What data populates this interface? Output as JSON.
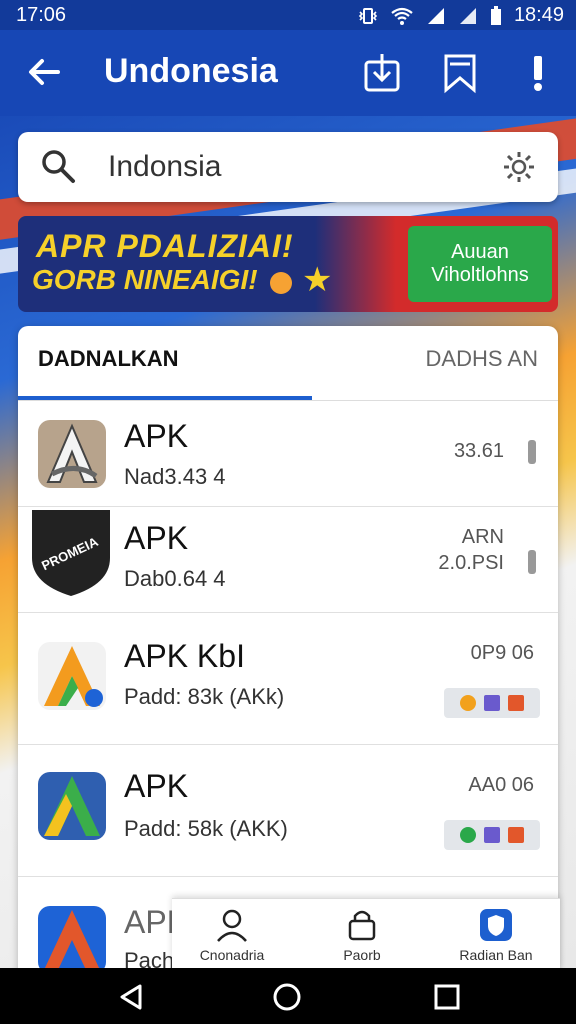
{
  "status": {
    "time_left": "17:06",
    "time_right": "18:49"
  },
  "appbar": {
    "title": "Undonesia"
  },
  "search": {
    "value": "Indonsia"
  },
  "banner": {
    "line1": "APR PDALIZIAI!",
    "line2": "GORB NINEAIGI!",
    "cta_line1": "Auuan",
    "cta_line2": "Viholtlohns"
  },
  "tabs": [
    {
      "label": "DADNALKAN"
    },
    {
      "label": "DADHS AN"
    }
  ],
  "apps": [
    {
      "name": "APK",
      "sub": "Nad3.43 4",
      "right": "33.61",
      "icon_label": ""
    },
    {
      "name": "APK",
      "sub": "Dab0.64 4",
      "right_top": "ARN",
      "right": "2.0.PSI",
      "icon_label": "PROMEIA"
    },
    {
      "name": "APK KbI",
      "sub": "Padd: 83k (AKk)",
      "right": "0P9 06"
    },
    {
      "name": "APK",
      "sub": "Padd: 58k (AKK)",
      "right": "AA0 06"
    },
    {
      "name": "APK",
      "sub": "Pach"
    }
  ],
  "bottom_nav": [
    {
      "label": "Cnonadria"
    },
    {
      "label": "Paorb"
    },
    {
      "label": "Radian Ban"
    }
  ],
  "colors": {
    "primary": "#1747b5",
    "accent_green": "#2aa84a",
    "tab_indicator": "#1d5fcf"
  }
}
